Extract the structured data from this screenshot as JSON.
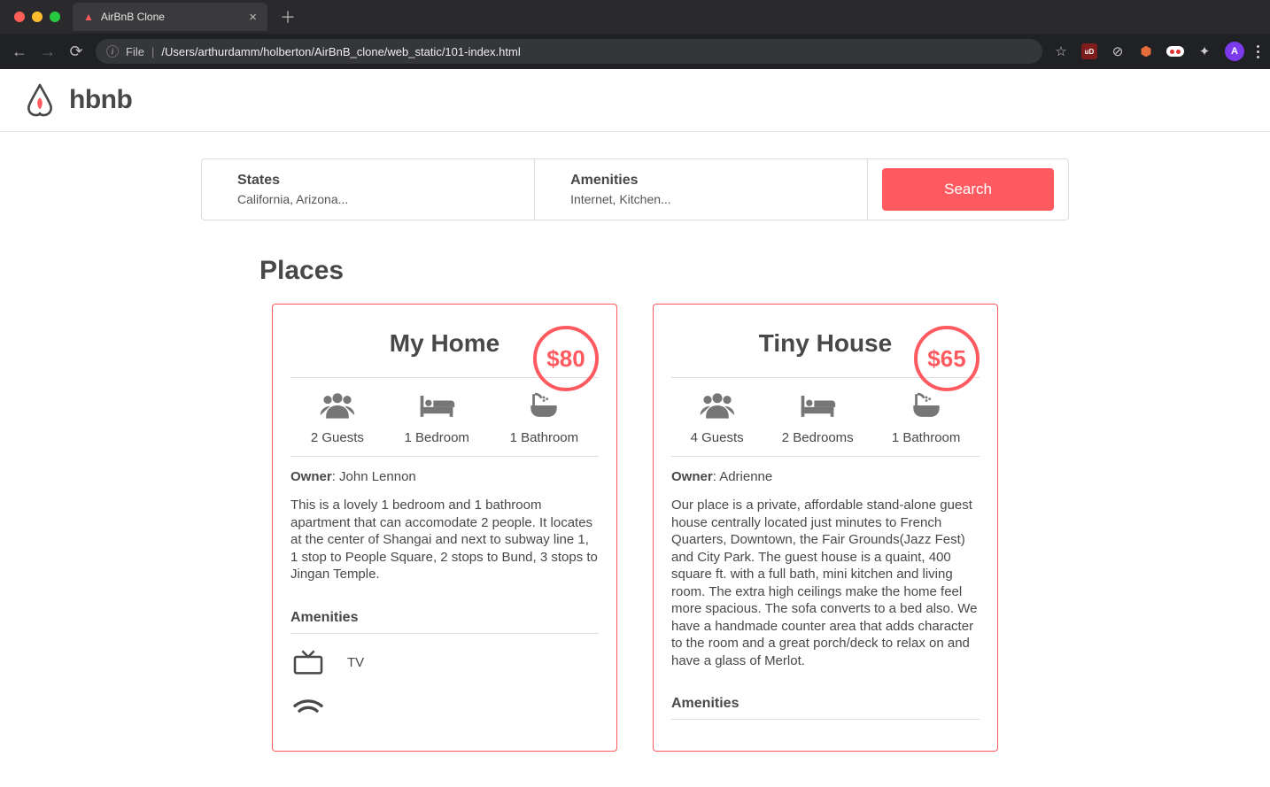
{
  "browser": {
    "tab_title": "AirBnB Clone",
    "url_scheme": "File",
    "url_path": "/Users/arthurdamm/holberton/AirBnB_clone/web_static/101-index.html",
    "avatar_letter": "A",
    "ext_ub": "uD"
  },
  "header": {
    "brand": "hbnb"
  },
  "filters": {
    "states": {
      "title": "States",
      "subtitle": "California, Arizona..."
    },
    "amenities": {
      "title": "Amenities",
      "subtitle": "Internet, Kitchen..."
    },
    "search_label": "Search"
  },
  "places": {
    "title": "Places",
    "cards": [
      {
        "name": "My Home",
        "price": "$80",
        "guests": "2 Guests",
        "bedrooms": "1 Bedroom",
        "bathrooms": "1 Bathroom",
        "owner_label": "Owner",
        "owner_name": ": John Lennon",
        "description": "This is a lovely 1 bedroom and 1 bathroom apartment that can accomodate 2 people. It locates at the center of Shangai and next to subway line 1, 1 stop to People Square, 2 stops to Bund, 3 stops to Jingan Temple.",
        "amenities_title": "Amenities",
        "amenities": [
          {
            "label": "TV"
          }
        ]
      },
      {
        "name": "Tiny House",
        "price": "$65",
        "guests": "4 Guests",
        "bedrooms": "2 Bedrooms",
        "bathrooms": "1 Bathroom",
        "owner_label": "Owner",
        "owner_name": ": Adrienne",
        "description": "Our place is a private, affordable stand-alone guest house centrally located just minutes to French Quarters, Downtown, the Fair Grounds(Jazz Fest) and City Park. The guest house is a quaint, 400 square ft. with a full bath, mini kitchen and living room. The extra high ceilings make the home feel more spacious. The sofa converts to a bed also. We have a handmade counter area that adds character to the room and a great porch/deck to relax on and have a glass of Merlot.",
        "amenities_title": "Amenities"
      }
    ]
  }
}
